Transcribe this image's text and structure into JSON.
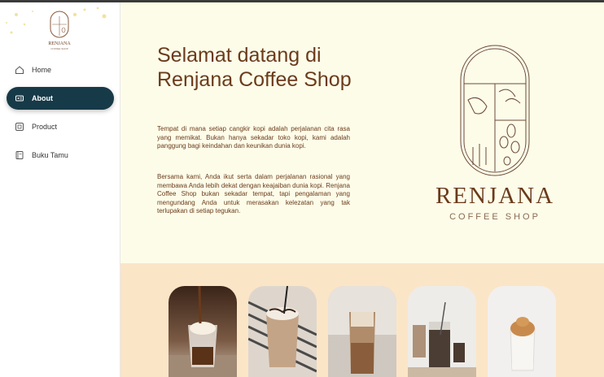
{
  "sidebar": {
    "logo_icon": "renjana-logo-icon",
    "items": [
      {
        "label": "Home",
        "icon": "home-icon",
        "active": false
      },
      {
        "label": "About",
        "icon": "about-icon",
        "active": true
      },
      {
        "label": "Product",
        "icon": "product-icon",
        "active": false
      },
      {
        "label": "Buku Tamu",
        "icon": "guestbook-icon",
        "active": false
      }
    ]
  },
  "hero": {
    "title": "Selamat datang di Renjana Coffee Shop",
    "paragraph1": "Tempat di mana setiap cangkir kopi adalah perjalanan cita rasa yang memikat. Bukan hanya sekadar toko kopi, kami adalah panggung bagi keindahan dan keunikan dunia kopi.",
    "paragraph2": "Bersama kami, Anda ikut serta dalam perjalanan rasional yang membawa Anda lebih dekat dengan keajaiban dunia kopi. Renjana Coffee Shop bukan sekadar tempat, tapi pengalaman yang mengundang Anda untuk merasakan kelezatan yang tak terlupakan di setiap tegukan.",
    "brand_name": "RENJANA",
    "brand_sub": "COFFEE SHOP"
  },
  "products": [
    {
      "icon": "affogato-photo"
    },
    {
      "icon": "iced-mocha-photo"
    },
    {
      "icon": "iced-latte-photo"
    },
    {
      "icon": "cold-brew-photo"
    },
    {
      "icon": "dalgona-photo"
    }
  ],
  "colors": {
    "accent": "#173a48",
    "brown": "#6b3b1c",
    "hero_bg": "#fdfce9",
    "products_bg": "#fbe5c7"
  }
}
